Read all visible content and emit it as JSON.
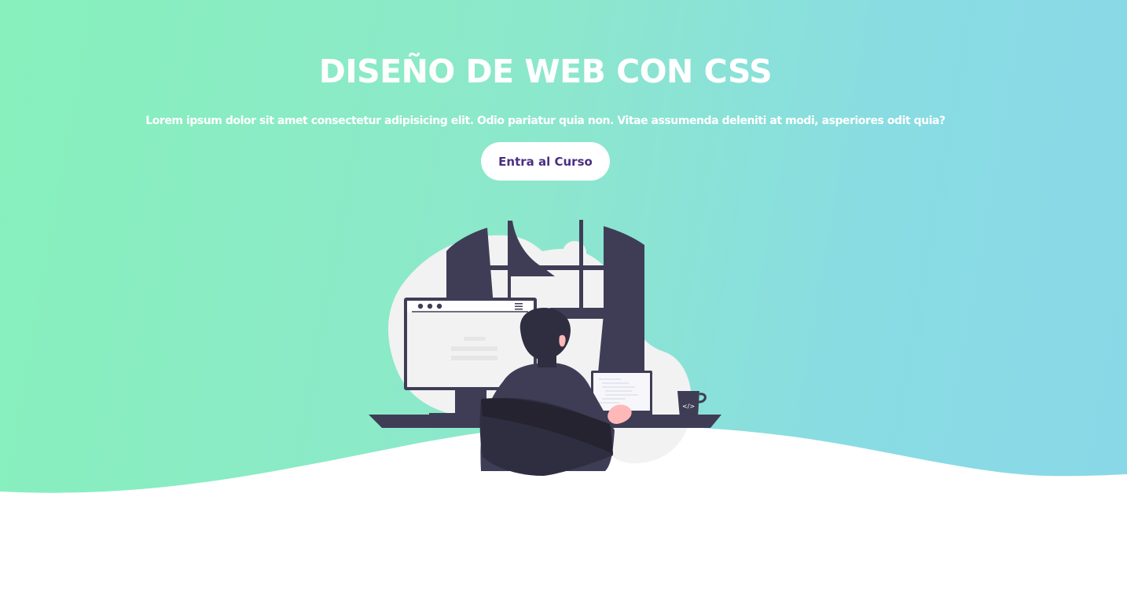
{
  "hero": {
    "title": "DISEÑO DE WEB CON CSS",
    "subtitle": "Lorem ipsum dolor sit amet consectetur adipisicing elit. Odio pariatur quia non. Vitae assumenda deleniti at modi, asperiores odit quia?",
    "cta_label": "Entra al Curso"
  },
  "illustration": {
    "name": "developer-at-desk-illustration",
    "code_symbol": "</>"
  },
  "colors": {
    "gradient_start": "#87f0bc",
    "gradient_end": "#89d8e8",
    "button_bg": "#ffffff",
    "button_text": "#4a2f82",
    "dark_ink": "#3f3d56",
    "light_blob": "#f2f2f2"
  }
}
